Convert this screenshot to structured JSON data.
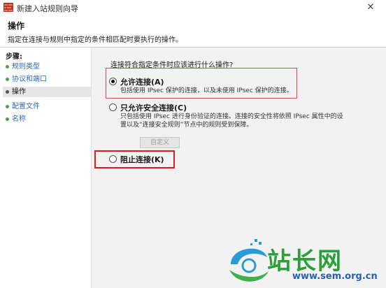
{
  "window": {
    "title": "新建入站规则向导"
  },
  "header": {
    "title": "操作",
    "description": "指定在连接与规则中指定的条件相匹配时要执行的操作。"
  },
  "sidebar": {
    "heading": "步骤:",
    "items": [
      {
        "label": "规则类型",
        "current": false
      },
      {
        "label": "协议和端口",
        "current": false
      },
      {
        "label": "操作",
        "current": true
      },
      {
        "label": "配置文件",
        "current": false
      },
      {
        "label": "名称",
        "current": false
      }
    ]
  },
  "main": {
    "question": "连接符合指定条件时应该进行什么操作?",
    "options": [
      {
        "label": "允许连接(A)",
        "selected": true,
        "description": [
          "包括使用 IPsec 保护的连接，以及未使用 IPsec 保护的连接。"
        ]
      },
      {
        "label": "只允许安全连接(C)",
        "selected": false,
        "description": [
          "只包括使用 IPsec 进行身份验证的连接。连接的安全性将依照 IPsec 属性中的设",
          "置以及“连接安全规则”节点中的规则受到保障。"
        ]
      },
      {
        "label": "阻止连接(K)",
        "selected": false,
        "description": []
      }
    ],
    "customize_label": "自定义"
  },
  "watermark": {
    "text": "站长网",
    "url": "www.sem.org.cn"
  },
  "colors": {
    "highlight_box": "#e01b1b",
    "link": "#2e6bb5",
    "content_bg": "#f2f2f2"
  }
}
